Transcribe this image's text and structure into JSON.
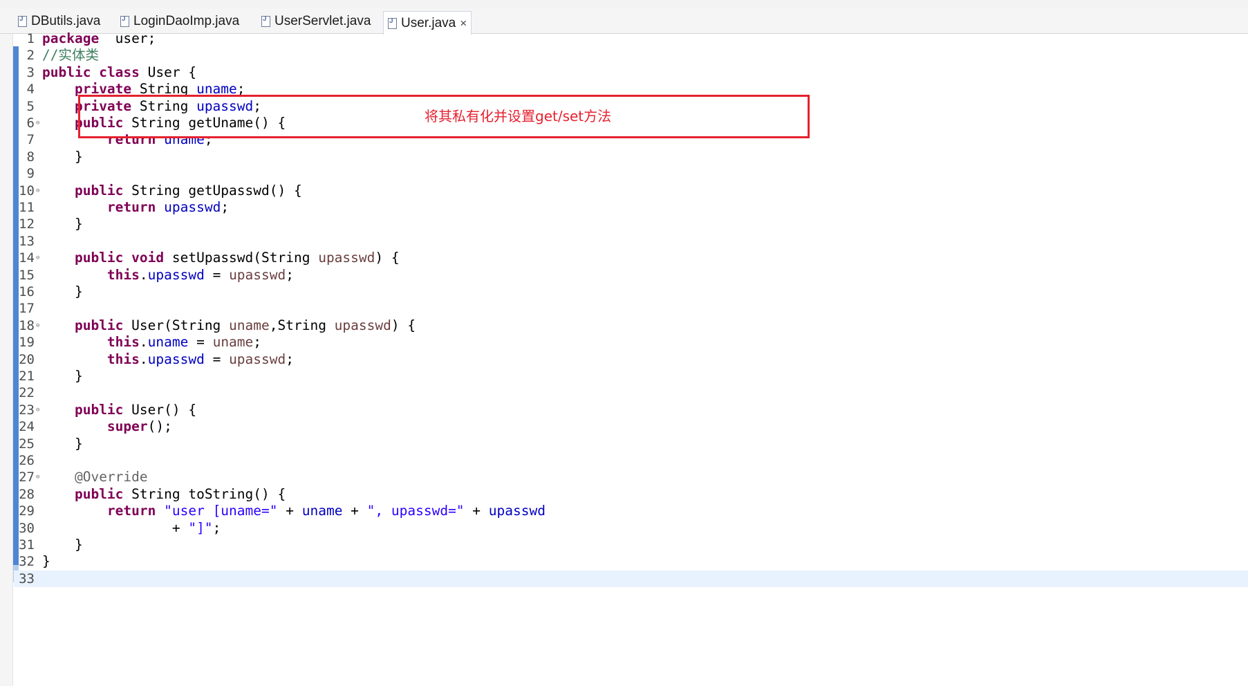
{
  "tabs": [
    {
      "label": "DButils.java",
      "active": false
    },
    {
      "label": "LoginDaoImp.java",
      "active": false
    },
    {
      "label": "UserServlet.java",
      "active": false
    },
    {
      "label": "User.java",
      "active": true
    }
  ],
  "tab_close_glyph": "×",
  "callout_text": "将其私有化并设置get/set方法",
  "colors": {
    "keyword": "#7f0055",
    "field": "#0000c0",
    "parameter": "#6a3e3e",
    "string": "#2a00ff",
    "comment": "#3f7f5f",
    "annotation": "#646464",
    "callout": "#e5212e",
    "current_line": "#e8f2fe"
  },
  "code_lines": [
    {
      "n": "1",
      "fold": false,
      "tokens": [
        [
          "kw",
          "package"
        ],
        [
          "",
          "  user;"
        ]
      ]
    },
    {
      "n": "2",
      "fold": false,
      "tokens": [
        [
          "com",
          "//实体类"
        ]
      ]
    },
    {
      "n": "3",
      "fold": false,
      "tokens": [
        [
          "kw",
          "public"
        ],
        [
          "",
          " "
        ],
        [
          "kw",
          "class"
        ],
        [
          "",
          " User {"
        ]
      ]
    },
    {
      "n": "4",
      "fold": false,
      "tokens": [
        [
          "",
          "    "
        ],
        [
          "kw",
          "private"
        ],
        [
          "",
          " String "
        ],
        [
          "fld",
          "uname"
        ],
        [
          "",
          ";"
        ]
      ]
    },
    {
      "n": "5",
      "fold": false,
      "tokens": [
        [
          "",
          "    "
        ],
        [
          "kw",
          "private"
        ],
        [
          "",
          " String "
        ],
        [
          "fld",
          "upasswd"
        ],
        [
          "",
          ";"
        ]
      ]
    },
    {
      "n": "6",
      "fold": true,
      "tokens": [
        [
          "",
          "    "
        ],
        [
          "kw",
          "public"
        ],
        [
          "",
          " String getUname() {"
        ]
      ]
    },
    {
      "n": "7",
      "fold": false,
      "tokens": [
        [
          "",
          "        "
        ],
        [
          "kw",
          "return"
        ],
        [
          "",
          " "
        ],
        [
          "fld",
          "uname"
        ],
        [
          "",
          ";"
        ]
      ]
    },
    {
      "n": "8",
      "fold": false,
      "tokens": [
        [
          "",
          "    }"
        ]
      ]
    },
    {
      "n": "9",
      "fold": false,
      "tokens": []
    },
    {
      "n": "10",
      "fold": true,
      "tokens": [
        [
          "",
          "    "
        ],
        [
          "kw",
          "public"
        ],
        [
          "",
          " String getUpasswd() {"
        ]
      ]
    },
    {
      "n": "11",
      "fold": false,
      "tokens": [
        [
          "",
          "        "
        ],
        [
          "kw",
          "return"
        ],
        [
          "",
          " "
        ],
        [
          "fld",
          "upasswd"
        ],
        [
          "",
          ";"
        ]
      ]
    },
    {
      "n": "12",
      "fold": false,
      "tokens": [
        [
          "",
          "    }"
        ]
      ]
    },
    {
      "n": "13",
      "fold": false,
      "tokens": []
    },
    {
      "n": "14",
      "fold": true,
      "tokens": [
        [
          "",
          "    "
        ],
        [
          "kw",
          "public"
        ],
        [
          "",
          " "
        ],
        [
          "kw",
          "void"
        ],
        [
          "",
          " setUpasswd(String "
        ],
        [
          "par",
          "upasswd"
        ],
        [
          "",
          ") {"
        ]
      ]
    },
    {
      "n": "15",
      "fold": false,
      "tokens": [
        [
          "",
          "        "
        ],
        [
          "kw",
          "this"
        ],
        [
          "",
          "."
        ],
        [
          "fld",
          "upasswd"
        ],
        [
          "",
          " = "
        ],
        [
          "par",
          "upasswd"
        ],
        [
          "",
          ";"
        ]
      ]
    },
    {
      "n": "16",
      "fold": false,
      "tokens": [
        [
          "",
          "    }"
        ]
      ]
    },
    {
      "n": "17",
      "fold": false,
      "tokens": []
    },
    {
      "n": "18",
      "fold": true,
      "tokens": [
        [
          "",
          "    "
        ],
        [
          "kw",
          "public"
        ],
        [
          "",
          " User(String "
        ],
        [
          "par",
          "uname"
        ],
        [
          "",
          ",String "
        ],
        [
          "par",
          "upasswd"
        ],
        [
          "",
          ") {"
        ]
      ]
    },
    {
      "n": "19",
      "fold": false,
      "tokens": [
        [
          "",
          "        "
        ],
        [
          "kw",
          "this"
        ],
        [
          "",
          "."
        ],
        [
          "fld",
          "uname"
        ],
        [
          "",
          " = "
        ],
        [
          "par",
          "uname"
        ],
        [
          "",
          ";"
        ]
      ]
    },
    {
      "n": "20",
      "fold": false,
      "tokens": [
        [
          "",
          "        "
        ],
        [
          "kw",
          "this"
        ],
        [
          "",
          "."
        ],
        [
          "fld",
          "upasswd"
        ],
        [
          "",
          " = "
        ],
        [
          "par",
          "upasswd"
        ],
        [
          "",
          ";"
        ]
      ]
    },
    {
      "n": "21",
      "fold": false,
      "tokens": [
        [
          "",
          "    }"
        ]
      ]
    },
    {
      "n": "22",
      "fold": false,
      "tokens": []
    },
    {
      "n": "23",
      "fold": true,
      "tokens": [
        [
          "",
          "    "
        ],
        [
          "kw",
          "public"
        ],
        [
          "",
          " User() {"
        ]
      ]
    },
    {
      "n": "24",
      "fold": false,
      "tokens": [
        [
          "",
          "        "
        ],
        [
          "kw",
          "super"
        ],
        [
          "",
          "();"
        ]
      ]
    },
    {
      "n": "25",
      "fold": false,
      "tokens": [
        [
          "",
          "    }"
        ]
      ]
    },
    {
      "n": "26",
      "fold": false,
      "tokens": []
    },
    {
      "n": "27",
      "fold": true,
      "tokens": [
        [
          "",
          "    "
        ],
        [
          "ann",
          "@Override"
        ]
      ]
    },
    {
      "n": "28",
      "fold": false,
      "tokens": [
        [
          "",
          "    "
        ],
        [
          "kw",
          "public"
        ],
        [
          "",
          " String toString() {"
        ]
      ]
    },
    {
      "n": "29",
      "fold": false,
      "tokens": [
        [
          "",
          "        "
        ],
        [
          "kw",
          "return"
        ],
        [
          "",
          " "
        ],
        [
          "str",
          "\"user [uname=\""
        ],
        [
          "",
          " + "
        ],
        [
          "fld",
          "uname"
        ],
        [
          "",
          " + "
        ],
        [
          "str",
          "\", upasswd=\""
        ],
        [
          "",
          " + "
        ],
        [
          "fld",
          "upasswd"
        ]
      ]
    },
    {
      "n": "30",
      "fold": false,
      "tokens": [
        [
          "",
          "                + "
        ],
        [
          "str",
          "\"]\""
        ],
        [
          "",
          ";"
        ]
      ]
    },
    {
      "n": "31",
      "fold": false,
      "tokens": [
        [
          "",
          "    }"
        ]
      ]
    },
    {
      "n": "32",
      "fold": false,
      "tokens": [
        [
          "",
          "}"
        ]
      ]
    },
    {
      "n": "33",
      "fold": false,
      "tokens": [],
      "current": true
    }
  ]
}
